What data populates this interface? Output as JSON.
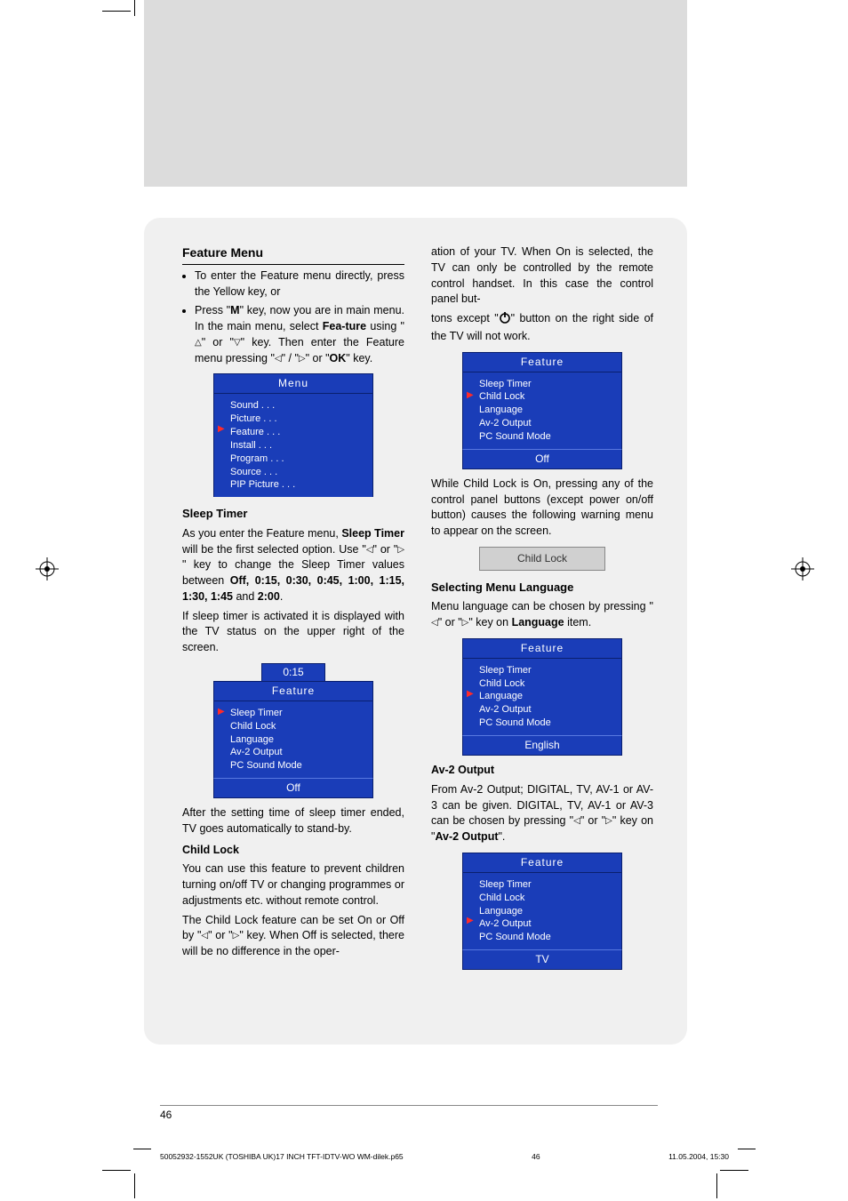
{
  "page_number": "46",
  "footer": {
    "left": "50052932-1552UK (TOSHIBA UK)17 INCH TFT-IDTV-WO WM-dilek.p65",
    "center": "46",
    "right": "11.05.2004, 15:30"
  },
  "left_col": {
    "h_feature": "Feature Menu",
    "b1": "To enter the Feature menu directly, press the Yellow key, or",
    "b2a": "Press \"",
    "b2_m": "M",
    "b2b": "\" key, now you are in main menu. In the main menu, select ",
    "b2_fea": "Fea-ture",
    "b2c": " using \"",
    "b2d": "\" or \"",
    "b2e": "\" key. Then enter the Feature menu pressing \"",
    "b2f": "\" / \"",
    "b2g": "\" or \"",
    "b2_ok": "OK",
    "b2h": "\" key.",
    "osd_menu": {
      "title": "Menu",
      "items": [
        "Sound . . .",
        "Picture . . .",
        "Feature . . .",
        "Install . . .",
        "Program . . .",
        "Source . . .",
        "PIP Picture . . ."
      ],
      "cursor_index": 2
    },
    "h_sleep": "Sleep Timer",
    "sleep_p1a": "As you enter the Feature menu, ",
    "sleep_bold": "Sleep Timer",
    "sleep_p1b": " will be the first selected option. Use \"",
    "sleep_p1c": "\" or \"",
    "sleep_p1d": "\" key to change the Sleep Timer values between ",
    "sleep_vals": "Off, 0:15, 0:30, 0:45, 1:00, 1:15, 1:30, 1:45",
    "sleep_and": " and ",
    "sleep_last": "2:00",
    "sleep_dot": ".",
    "sleep_p2": "If sleep timer is activated it is displayed with the TV status on the upper right of the screen.",
    "osd_sleep": {
      "badge": "0:15",
      "title": "Feature",
      "items": [
        "Sleep Timer",
        "Child Lock",
        "Language",
        "Av-2 Output",
        "PC Sound Mode"
      ],
      "cursor_index": 0,
      "foot": "Off"
    },
    "sleep_p3": "After the setting time of sleep timer ended, TV goes automatically to stand-by.",
    "h_child": "Child Lock",
    "child_p1": "You can use this feature to prevent children turning on/off TV or changing programmes or adjustments etc. without remote control.",
    "child_p2a": "The ",
    "child_cl": "Child Lock",
    "child_p2b": " feature can be set ",
    "child_on": "On",
    "child_p2c": " or ",
    "child_off": "Off",
    "child_p2d": " by \"",
    "child_p2e": "\" or \"",
    "child_p2f": "\" key. When ",
    "child_off2": "Off",
    "child_p2g": " is selected, there will be no difference in the oper-"
  },
  "right_col": {
    "cont_p1a": "ation of your TV. When ",
    "cont_on": "On",
    "cont_p1b": " is selected, the TV can only be controlled by the remote control handset. In this case the control panel but-",
    "cont_p2a": "tons except \"",
    "cont_p2b": "\" button on the right side of the TV will not work.",
    "osd_child": {
      "title": "Feature",
      "items": [
        "Sleep Timer",
        "Child Lock",
        "Language",
        "Av-2 Output",
        "PC Sound Mode"
      ],
      "cursor_index": 1,
      "foot": "Off"
    },
    "child_warn": "While Child Lock is On, pressing any of the control panel buttons (except power on/off button) causes the following warning menu to appear on the screen.",
    "lock_label": "Child Lock",
    "h_lang": "Selecting Menu Language",
    "lang_p1a": "Menu language can be chosen by pressing \"",
    "lang_p1b": "\" or \"",
    "lang_p1c": "\" key on ",
    "lang_bold": "Language",
    "lang_p1d": " item.",
    "osd_lang": {
      "title": "Feature",
      "items": [
        "Sleep Timer",
        "Child Lock",
        "Language",
        "Av-2 Output",
        "PC Sound Mode"
      ],
      "cursor_index": 2,
      "foot": "English"
    },
    "h_av2": "Av-2 Output",
    "av2_p1a": "From Av-2 Output; DIGITAL, TV, AV-1 or AV-3 can be given. DIGITAL, TV, AV-1 or AV-3 can be chosen by pressing \"",
    "av2_p1b": "\" or \"",
    "av2_p1c": "\" key on \"",
    "av2_bold": "Av-2 Output",
    "av2_p1d": "\".",
    "osd_av2": {
      "title": "Feature",
      "items": [
        "Sleep Timer",
        "Child Lock",
        "Language",
        "Av-2 Output",
        "PC Sound Mode"
      ],
      "cursor_index": 3,
      "foot": "TV"
    }
  }
}
